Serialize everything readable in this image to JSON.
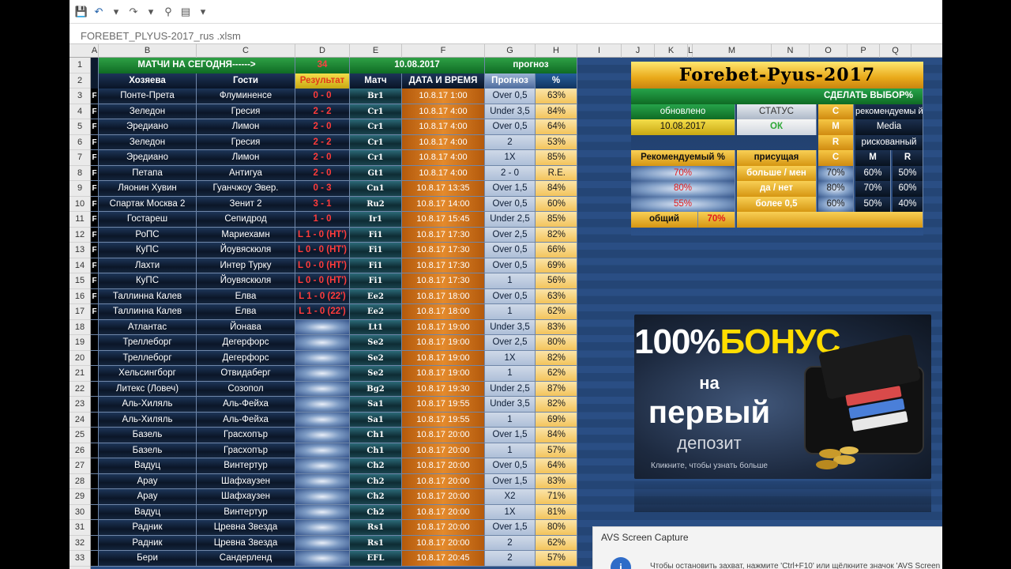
{
  "file_name": "FOREBET_PLYUS-2017_rus .xlsm",
  "columns": [
    "A",
    "B",
    "C",
    "D",
    "E",
    "F",
    "G",
    "H",
    "I",
    "J",
    "K",
    "L",
    "M",
    "N",
    "O",
    "P",
    "Q"
  ],
  "row_numbers": [
    "1",
    "2",
    "3",
    "4",
    "5",
    "6",
    "7",
    "8",
    "9",
    "10",
    "11",
    "12",
    "13",
    "14",
    "15",
    "16",
    "17",
    "18",
    "19",
    "20",
    "21",
    "22",
    "23",
    "24",
    "25",
    "26",
    "27",
    "28",
    "29",
    "30",
    "31",
    "32",
    "33"
  ],
  "header_row1": {
    "title": "МАТЧИ НА СЕГОДНЯ------>",
    "count": "34",
    "date": "10.08.2017",
    "forecast": "прогноз"
  },
  "header_row2": {
    "home": "Хозяева",
    "away": "Гости",
    "result": "Результат",
    "match": "Матч",
    "datetime": "ДАТА И ВРЕМЯ",
    "prediction": "Прогноз",
    "pct": "%"
  },
  "rows": [
    {
      "a": "F",
      "home": "Понте-Прета",
      "away": "Флуминенсе",
      "result": "0 - 0",
      "code": "Br1",
      "dt": "10.8.17 1:00",
      "pred": "Over 0,5",
      "pct": "63%"
    },
    {
      "a": "F",
      "home": "Зеледон",
      "away": "Гресия",
      "result": "2 - 2",
      "code": "Cr1",
      "dt": "10.8.17 4:00",
      "pred": "Under 3,5",
      "pct": "84%"
    },
    {
      "a": "F",
      "home": "Эредиано",
      "away": "Лимон",
      "result": "2 - 0",
      "code": "Cr1",
      "dt": "10.8.17 4:00",
      "pred": "Over 0,5",
      "pct": "64%"
    },
    {
      "a": "F",
      "home": "Зеледон",
      "away": "Гресия",
      "result": "2 - 2",
      "code": "Cr1",
      "dt": "10.8.17 4:00",
      "pred": "2",
      "pct": "53%"
    },
    {
      "a": "F",
      "home": "Эредиано",
      "away": "Лимон",
      "result": "2 - 0",
      "code": "Cr1",
      "dt": "10.8.17 4:00",
      "pred": "1X",
      "pct": "85%"
    },
    {
      "a": "F",
      "home": "Петапа",
      "away": "Антигуа",
      "result": "2 - 0",
      "code": "Gt1",
      "dt": "10.8.17 4:00",
      "pred": "2 - 0",
      "pct": "R.E."
    },
    {
      "a": "F",
      "home": "Ляонин Хувин",
      "away": "Гуанчжоу Эвер.",
      "result": "0 - 3",
      "code": "Cn1",
      "dt": "10.8.17 13:35",
      "pred": "Over 1,5",
      "pct": "84%"
    },
    {
      "a": "F",
      "home": "Спартак Москва 2",
      "away": "Зенит 2",
      "result": "3 - 1",
      "code": "Ru2",
      "dt": "10.8.17 14:00",
      "pred": "Over 0,5",
      "pct": "60%"
    },
    {
      "a": "F",
      "home": "Гостареш",
      "away": "Сепидрод",
      "result": "1 - 0",
      "code": "Ir1",
      "dt": "10.8.17 15:45",
      "pred": "Under 2,5",
      "pct": "85%"
    },
    {
      "a": "F",
      "home": "РоПС",
      "away": "Мариехамн",
      "result": "L 1 - 0 (HT')",
      "code": "Fi1",
      "dt": "10.8.17 17:30",
      "pred": "Over 2,5",
      "pct": "82%"
    },
    {
      "a": "F",
      "home": "КуПС",
      "away": "Йоувяскюля",
      "result": "L 0 - 0 (HT')",
      "code": "Fi1",
      "dt": "10.8.17 17:30",
      "pred": "Over 0,5",
      "pct": "66%"
    },
    {
      "a": "F",
      "home": "Лахти",
      "away": "Интер Турку",
      "result": "L 0 - 0 (HT')",
      "code": "Fi1",
      "dt": "10.8.17 17:30",
      "pred": "Over 0,5",
      "pct": "69%"
    },
    {
      "a": "F",
      "home": "КуПС",
      "away": "Йоувяскюля",
      "result": "L 0 - 0 (HT')",
      "code": "Fi1",
      "dt": "10.8.17 17:30",
      "pred": "1",
      "pct": "56%"
    },
    {
      "a": "F",
      "home": "Таллинна Калев",
      "away": "Елва",
      "result": "L 1 - 0 (22')",
      "code": "Ee2",
      "dt": "10.8.17 18:00",
      "pred": "Over 0,5",
      "pct": "63%"
    },
    {
      "a": "F",
      "home": "Таллинна Калев",
      "away": "Елва",
      "result": "L 1 - 0 (22')",
      "code": "Ee2",
      "dt": "10.8.17 18:00",
      "pred": "1",
      "pct": "62%"
    },
    {
      "a": "",
      "home": "Атлантас",
      "away": "Йонава",
      "result": "",
      "code": "Lt1",
      "dt": "10.8.17 19:00",
      "pred": "Under 3,5",
      "pct": "83%"
    },
    {
      "a": "",
      "home": "Треллеборг",
      "away": "Дегерфорс",
      "result": "",
      "code": "Se2",
      "dt": "10.8.17 19:00",
      "pred": "Over 2,5",
      "pct": "80%"
    },
    {
      "a": "",
      "home": "Треллеборг",
      "away": "Дегерфорс",
      "result": "",
      "code": "Se2",
      "dt": "10.8.17 19:00",
      "pred": "1X",
      "pct": "82%"
    },
    {
      "a": "",
      "home": "Хельсингборг",
      "away": "Отвидаберг",
      "result": "",
      "code": "Se2",
      "dt": "10.8.17 19:00",
      "pred": "1",
      "pct": "62%"
    },
    {
      "a": "",
      "home": "Литекс (Ловеч)",
      "away": "Созопол",
      "result": "",
      "code": "Bg2",
      "dt": "10.8.17 19:30",
      "pred": "Under 2,5",
      "pct": "87%"
    },
    {
      "a": "",
      "home": "Аль-Хиляль",
      "away": "Аль-Фейха",
      "result": "",
      "code": "Sa1",
      "dt": "10.8.17 19:55",
      "pred": "Under 3,5",
      "pct": "82%"
    },
    {
      "a": "",
      "home": "Аль-Хиляль",
      "away": "Аль-Фейха",
      "result": "",
      "code": "Sa1",
      "dt": "10.8.17 19:55",
      "pred": "1",
      "pct": "69%"
    },
    {
      "a": "",
      "home": "Базель",
      "away": "Грасхопър",
      "result": "",
      "code": "Ch1",
      "dt": "10.8.17 20:00",
      "pred": "Over 1,5",
      "pct": "84%"
    },
    {
      "a": "",
      "home": "Базель",
      "away": "Грасхопър",
      "result": "",
      "code": "Ch1",
      "dt": "10.8.17 20:00",
      "pred": "1",
      "pct": "57%"
    },
    {
      "a": "",
      "home": "Вадуц",
      "away": "Винтертур",
      "result": "",
      "code": "Ch2",
      "dt": "10.8.17 20:00",
      "pred": "Over 0,5",
      "pct": "64%"
    },
    {
      "a": "",
      "home": "Арау",
      "away": "Шафхаузен",
      "result": "",
      "code": "Ch2",
      "dt": "10.8.17 20:00",
      "pred": "Over 1,5",
      "pct": "83%"
    },
    {
      "a": "",
      "home": "Арау",
      "away": "Шафхаузен",
      "result": "",
      "code": "Ch2",
      "dt": "10.8.17 20:00",
      "pred": "X2",
      "pct": "71%"
    },
    {
      "a": "",
      "home": "Вадуц",
      "away": "Винтертур",
      "result": "",
      "code": "Ch2",
      "dt": "10.8.17 20:00",
      "pred": "1X",
      "pct": "81%"
    },
    {
      "a": "",
      "home": "Радник",
      "away": "Цревна Звезда",
      "result": "",
      "code": "Rs1",
      "dt": "10.8.17 20:00",
      "pred": "Over 1,5",
      "pct": "80%"
    },
    {
      "a": "",
      "home": "Радник",
      "away": "Цревна Звезда",
      "result": "",
      "code": "Rs1",
      "dt": "10.8.17 20:00",
      "pred": "2",
      "pct": "62%"
    },
    {
      "a": "",
      "home": "Бери",
      "away": "Сандерленд",
      "result": "",
      "code": "EFL",
      "dt": "10.8.17 20:45",
      "pred": "2",
      "pct": "57%"
    }
  ],
  "panel": {
    "logo": "Forebet-Pyus-2017",
    "make_choice": "СДЕЛАТЬ ВЫБОР%",
    "updated_label": "обновлено",
    "updated_date": "10.08.2017",
    "status_label": "СТАТУС",
    "status_value": "ОК",
    "c_letter": "C",
    "m_letter": "M",
    "r_letter": "R",
    "recommended_text": "рекомендуемы й",
    "media_text": "Media",
    "risky_text": "рискованный",
    "recommended_pct_label": "Рекомендуемый %",
    "pct1": "70%",
    "pct2": "80%",
    "pct3": "55%",
    "inherent_label": "присущая",
    "more_less": "больше / мен",
    "yes_no": "да / нет",
    "more_05": "более 0,5",
    "col_c": "C",
    "col_m": "M",
    "col_r": "R",
    "t_row1": [
      "70%",
      "60%",
      "50%"
    ],
    "t_row2": [
      "80%",
      "70%",
      "60%"
    ],
    "t_row3": [
      "60%",
      "50%",
      "40%"
    ],
    "total_label": "общий",
    "total_value": "70%"
  },
  "banner": {
    "part1": "100%",
    "part2": "БОНУС",
    "part3": "на",
    "part4": "первый",
    "part5": "депозит",
    "part6": "Кликните, чтобы узнать больше"
  },
  "avs": {
    "title": "AVS Screen Capture",
    "message": "Чтобы остановить захват, нажмите 'Ctrl+F10' или щёлкните значок 'AVS Screen Ca"
  }
}
